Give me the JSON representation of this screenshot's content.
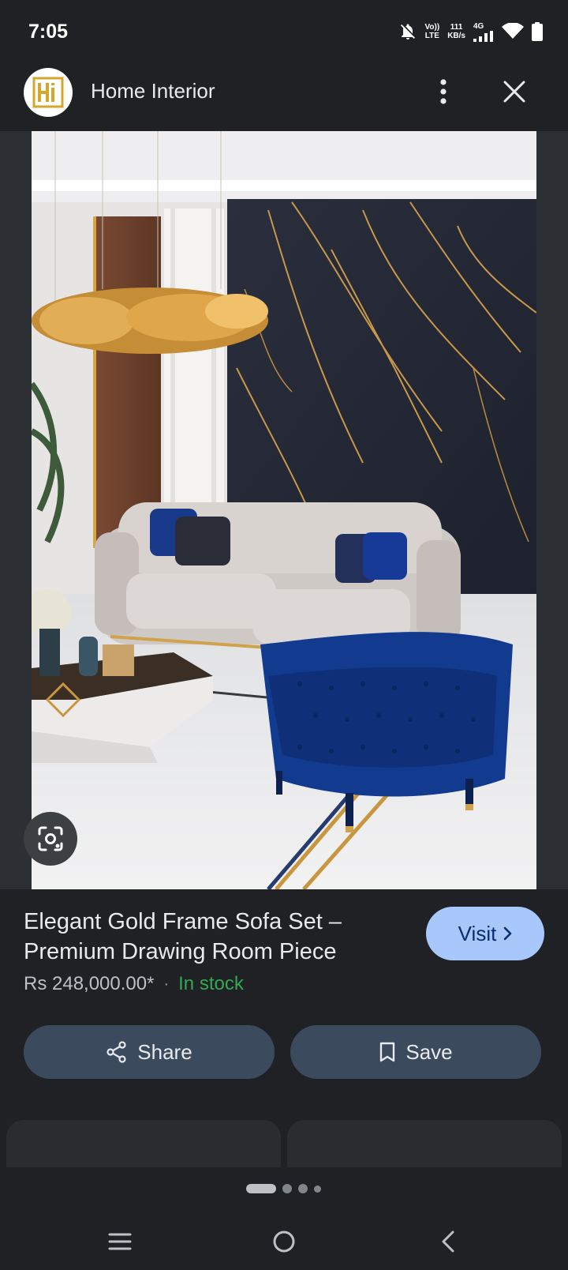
{
  "status_bar": {
    "time": "7:05",
    "volte_top": "Vo))",
    "volte_bottom": "LTE",
    "speed_value": "111",
    "speed_unit": "KB/s",
    "network": "4G"
  },
  "header": {
    "logo_text": "Hi",
    "site_name": "Home Interior"
  },
  "product": {
    "title": "Elegant Gold Frame Sofa Set – Premium Drawing Room Piece",
    "price": "Rs 248,000.00*",
    "separator": "·",
    "stock": "In stock",
    "visit_label": "Visit"
  },
  "actions": {
    "share_label": "Share",
    "save_label": "Save"
  },
  "colors": {
    "background": "#202124",
    "visit_button": "#a8c7fa",
    "action_button": "#3c4a5e",
    "in_stock": "#34a853",
    "logo_gold": "#d4a72c"
  },
  "icons": {
    "more": "more-vert-icon",
    "close": "close-icon",
    "lens": "lens-search-icon",
    "share": "share-icon",
    "save": "bookmark-icon",
    "recents": "menu-icon",
    "home": "home-circle-icon",
    "back": "back-chevron-icon"
  }
}
